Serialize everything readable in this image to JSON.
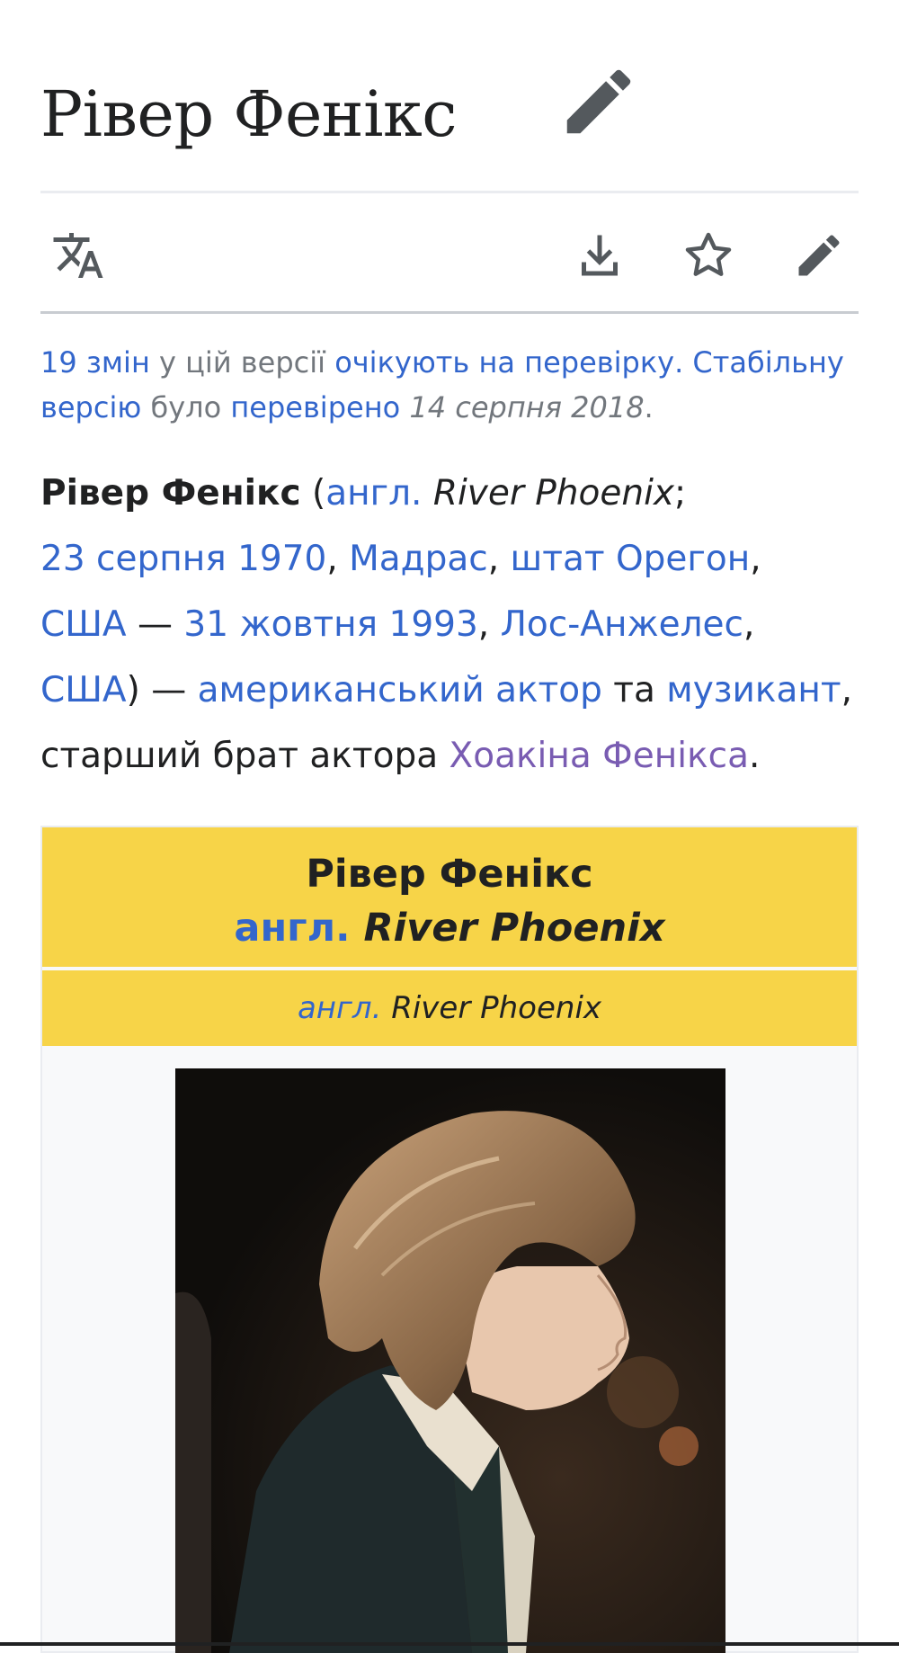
{
  "page": {
    "title": "Рівер Фенікс"
  },
  "toolbar": {
    "language_icon": "translate-icon",
    "download_icon": "download-icon",
    "watch_icon": "star-icon",
    "edit_icon": "pencil-icon"
  },
  "review": {
    "changes_link": "19 змін",
    "text1": " у цій версії ",
    "pending_link": "очікують на перевірку.",
    "space": " ",
    "stable_link1": "Стабільну",
    "stable_link2": "версію",
    "text2": " було ",
    "checked_link": "перевірено",
    "date": " 14 серпня 2018",
    "period": "."
  },
  "lead": {
    "name": "Рівер Фенікс",
    "open_paren": " (",
    "lang_abbr": "англ.",
    "original_name": " River Phoenix",
    "semicolon": ";",
    "birth_date": "23 серпня 1970",
    "comma1": ", ",
    "birth_place": "Мадрас",
    "comma2": ", ",
    "birth_state": "штат Орегон",
    "comma3": ",",
    "usa1": "США",
    "dash1": " — ",
    "death_date": "31 жовтня 1993",
    "comma4": ", ",
    "death_place": "Лос-Анжелес",
    "comma5": ",",
    "usa2": "США",
    "close_paren": ") — ",
    "occupation1": "американський актор",
    "and": " та ",
    "occupation2": "музикант",
    "comma6": ",",
    "brother_text": "старший брат актора ",
    "brother_link": "Хоакіна Фенікса",
    "final_period": "."
  },
  "infobox": {
    "name": "Рівер Фенікс",
    "lang_abbr": "англ.",
    "original_name": "River Phoenix",
    "sub_lang_abbr": "англ.",
    "sub_original_name": "River Phoenix",
    "header_color": "#f7d448"
  },
  "colors": {
    "link": "#3366cc",
    "visited_link": "#795cb2",
    "text": "#202122",
    "muted": "#72777d"
  }
}
